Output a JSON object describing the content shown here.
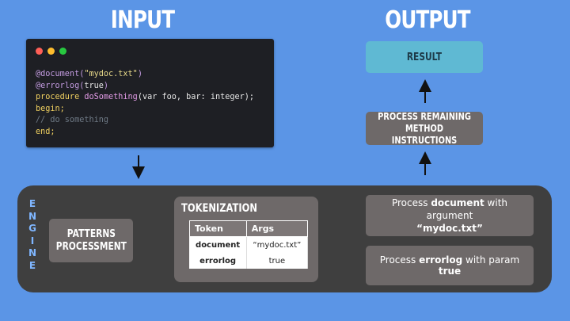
{
  "headings": {
    "input": "INPUT",
    "output": "OUTPUT"
  },
  "code_window": {
    "lines": [
      [
        {
          "t": "@document(",
          "c": "attr"
        },
        {
          "t": "\"mydoc.txt\"",
          "c": "str"
        },
        {
          "t": ")",
          "c": "attr"
        }
      ],
      [
        {
          "t": "@errorlog(",
          "c": "attr"
        },
        {
          "t": "true",
          "c": "plain"
        },
        {
          "t": ")",
          "c": "attr"
        }
      ],
      [
        {
          "t": "procedure ",
          "c": "kw"
        },
        {
          "t": "doSomething",
          "c": "fn"
        },
        {
          "t": "(var foo, bar: integer);",
          "c": "plain"
        }
      ],
      [
        {
          "t": "begin;",
          "c": "kw"
        }
      ],
      [
        {
          "t": "// do something",
          "c": "comment"
        }
      ],
      [
        {
          "t": "end;",
          "c": "kw"
        }
      ]
    ]
  },
  "engine": {
    "label": [
      "E",
      "N",
      "G",
      "I",
      "N",
      "E"
    ]
  },
  "patterns": {
    "line1": "PATTERNS",
    "line2": "PROCESSMENT"
  },
  "tokenization": {
    "title": "TOKENIZATION",
    "columns": [
      "Token",
      "Args"
    ],
    "rows": [
      {
        "token": "document",
        "args": "“mydoc.txt”"
      },
      {
        "token": "errorlog",
        "args": "true"
      }
    ]
  },
  "process_document": {
    "prefix": "Process ",
    "keyword": "document",
    "middle": " with argument",
    "argument": "“mydoc.txt”"
  },
  "process_errorlog": {
    "prefix": "Process ",
    "keyword": "errorlog",
    "middle": " with param ",
    "argument": "true"
  },
  "process_remaining": {
    "line1": "PROCESS REMAINING",
    "line2": "METHOD INSTRUCTIONS"
  },
  "result": {
    "label": "RESULT"
  },
  "colors": {
    "background": "#5b95e6",
    "engine": "#3f3f3f",
    "box": "#6e6969",
    "result": "#5fb9d3",
    "connector": "#8fc7ff",
    "engine_label": "#7fb6ff"
  }
}
